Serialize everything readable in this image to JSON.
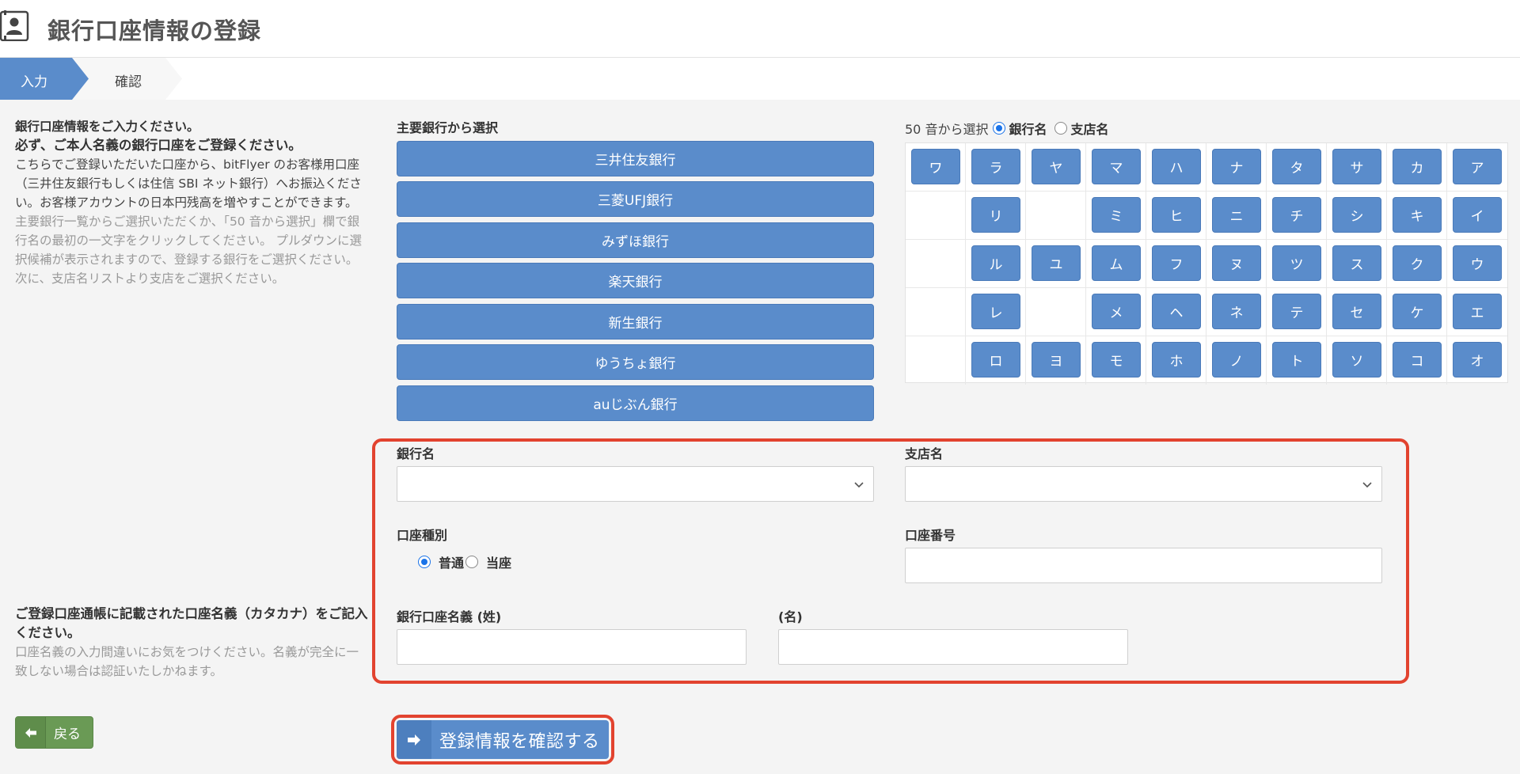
{
  "header": {
    "title": "銀行口座情報の登録"
  },
  "steps": [
    {
      "label": "入力"
    },
    {
      "label": "確認"
    }
  ],
  "intro": {
    "line1": "銀行口座情報をご入力ください。",
    "line2": "必ず、ご本人名義の銀行口座をご登録ください。",
    "desc": "こちらでご登録いただいた口座から、bitFlyer のお客様用口座（三井住友銀行もしくは住信 SBI ネット銀行）へお振込ください。お客様アカウントの日本円残高を増やすことができます。",
    "help": "主要銀行一覧からご選択いただくか、「50 音から選択」欄で銀行名の最初の一文字をクリックしてください。 プルダウンに選択候補が表示されますので、登録する銀行をご選択ください。 次に、支店名リストより支店をご選択ください。"
  },
  "major_banks": {
    "label": "主要銀行から選択",
    "items": [
      "三井住友銀行",
      "三菱UFJ銀行",
      "みずほ銀行",
      "楽天銀行",
      "新生銀行",
      "ゆうちょ銀行",
      "auじぶん銀行"
    ]
  },
  "kana": {
    "label": "50 音から選択",
    "option_bank": "銀行名",
    "option_branch": "支店名",
    "selected": "銀行名",
    "rows": [
      [
        "ワ",
        "ラ",
        "ヤ",
        "マ",
        "ハ",
        "ナ",
        "タ",
        "サ",
        "カ",
        "ア"
      ],
      [
        "",
        "リ",
        "",
        "ミ",
        "ヒ",
        "ニ",
        "チ",
        "シ",
        "キ",
        "イ"
      ],
      [
        "",
        "ル",
        "ユ",
        "ム",
        "フ",
        "ヌ",
        "ツ",
        "ス",
        "ク",
        "ウ"
      ],
      [
        "",
        "レ",
        "",
        "メ",
        "ヘ",
        "ネ",
        "テ",
        "セ",
        "ケ",
        "エ"
      ],
      [
        "",
        "ロ",
        "ヨ",
        "モ",
        "ホ",
        "ノ",
        "ト",
        "ソ",
        "コ",
        "オ"
      ]
    ]
  },
  "form": {
    "bank_name_label": "銀行名",
    "branch_name_label": "支店名",
    "account_type_label": "口座種別",
    "account_type_options": [
      "普通",
      "当座"
    ],
    "account_type_selected": "普通",
    "account_number_label": "口座番号",
    "holder_last_label": "銀行口座名義 (姓)",
    "holder_first_label": "(名)",
    "bank_name_value": "",
    "branch_name_value": "",
    "account_number_value": "",
    "holder_last_value": "",
    "holder_first_value": ""
  },
  "holder_note": {
    "title": "ご登録口座通帳に記載された口座名義（カタカナ）をご記入ください。",
    "help": "口座名義の入力間違いにお気をつけください。名義が完全に一致しない場合は認証いたしかねます。"
  },
  "buttons": {
    "back": "戻る",
    "confirm": "登録情報を確認する"
  },
  "colors": {
    "primary": "#5a8ccb",
    "back": "#6a9a55",
    "highlight": "#e2432f"
  }
}
